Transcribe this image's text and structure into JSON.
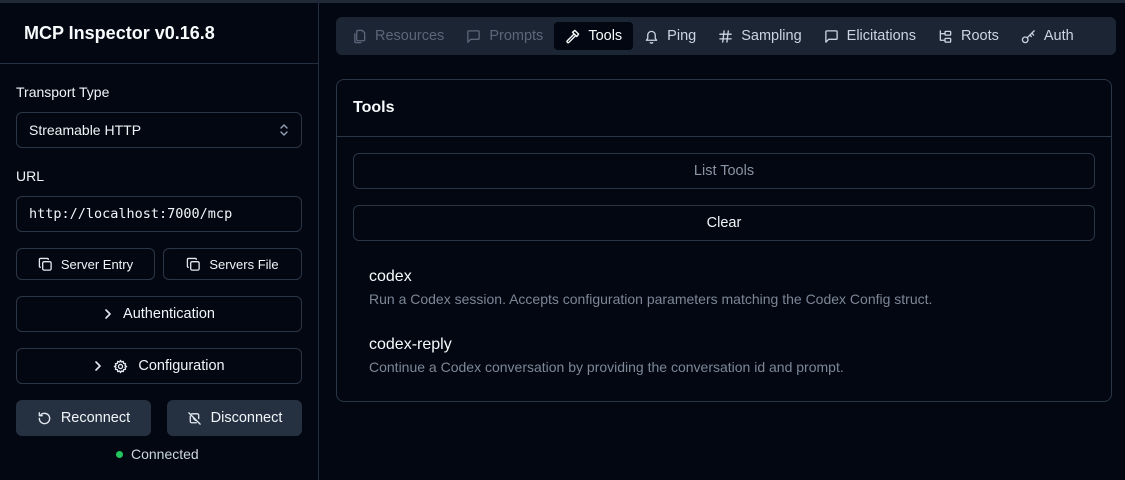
{
  "app": {
    "title": "MCP Inspector v0.16.8"
  },
  "sidebar": {
    "transport_label": "Transport Type",
    "transport_value": "Streamable HTTP",
    "url_label": "URL",
    "url_value": "http://localhost:7000/mcp",
    "server_entry_label": "Server Entry",
    "servers_file_label": "Servers File",
    "authentication_label": "Authentication",
    "configuration_label": "Configuration",
    "reconnect_label": "Reconnect",
    "disconnect_label": "Disconnect",
    "status_text": "Connected",
    "status_color": "#22c55e"
  },
  "tabs": [
    {
      "label": "Resources",
      "icon": "files-icon",
      "state": "disabled"
    },
    {
      "label": "Prompts",
      "icon": "message-square-icon",
      "state": "disabled"
    },
    {
      "label": "Tools",
      "icon": "hammer-icon",
      "state": "active"
    },
    {
      "label": "Ping",
      "icon": "bell-icon",
      "state": "normal"
    },
    {
      "label": "Sampling",
      "icon": "hash-icon",
      "state": "normal"
    },
    {
      "label": "Elicitations",
      "icon": "message-square-icon",
      "state": "normal"
    },
    {
      "label": "Roots",
      "icon": "folder-tree-icon",
      "state": "normal"
    },
    {
      "label": "Auth",
      "icon": "key-icon",
      "state": "normal"
    }
  ],
  "tools_panel": {
    "title": "Tools",
    "list_tools_label": "List Tools",
    "clear_label": "Clear",
    "tools": [
      {
        "name": "codex",
        "description": "Run a Codex session. Accepts configuration parameters matching the Codex Config struct."
      },
      {
        "name": "codex-reply",
        "description": "Continue a Codex conversation by providing the conversation id and prompt."
      }
    ]
  },
  "colors": {
    "background": "#020711",
    "accent_surface": "#253041",
    "status_connected": "#22c55e"
  }
}
